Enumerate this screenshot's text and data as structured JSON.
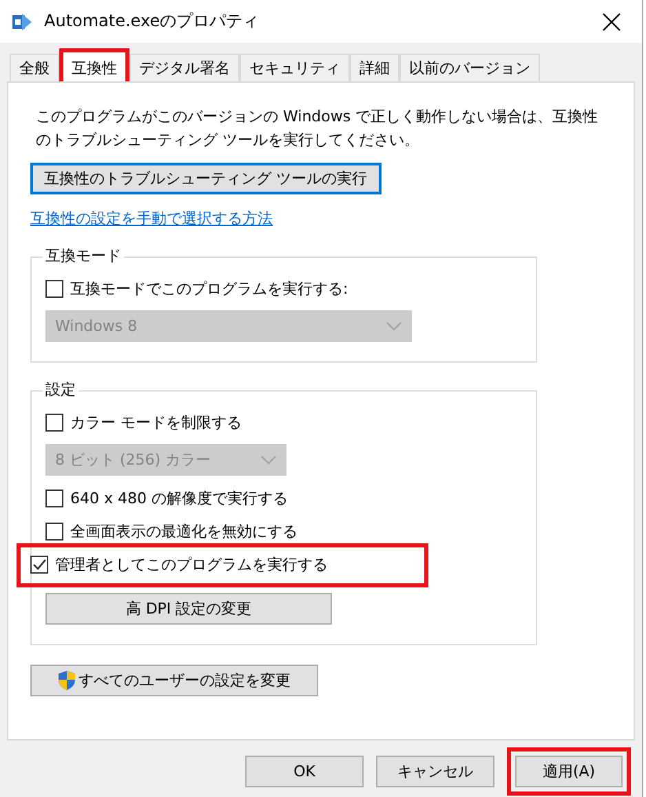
{
  "window": {
    "title": "Automate.exeのプロパティ"
  },
  "tabs": [
    {
      "label": "全般",
      "selected": false,
      "highlighted": false
    },
    {
      "label": "互換性",
      "selected": true,
      "highlighted": true
    },
    {
      "label": "デジタル署名",
      "selected": false,
      "highlighted": false
    },
    {
      "label": "セキュリティ",
      "selected": false,
      "highlighted": false
    },
    {
      "label": "詳細",
      "selected": false,
      "highlighted": false
    },
    {
      "label": "以前のバージョン",
      "selected": false,
      "highlighted": false
    }
  ],
  "description": "このプログラムがこのバージョンの Windows で正しく動作しない場合は、互換性のトラブルシューティング ツールを実行してください。",
  "troubleshoot_button": {
    "label": "互換性のトラブルシューティング ツールの実行",
    "focused": true
  },
  "help_link": "互換性の設定を手動で選択する方法",
  "groups": [
    {
      "title": "互換モード",
      "items": [
        {
          "kind": "checkbox",
          "label": "互換モードでこのプログラムを実行する:",
          "checked": false,
          "highlighted": false
        },
        {
          "kind": "dropdown",
          "value": "Windows 8",
          "disabled": true
        }
      ]
    },
    {
      "title": "設定",
      "items": [
        {
          "kind": "checkbox",
          "label": "カラー モードを制限する",
          "checked": false,
          "highlighted": false
        },
        {
          "kind": "dropdown",
          "value": "8 ビット (256) カラー",
          "disabled": true
        },
        {
          "kind": "checkbox",
          "label": "640 x 480 の解像度で実行する",
          "checked": false,
          "highlighted": false
        },
        {
          "kind": "checkbox",
          "label": "全画面表示の最適化を無効にする",
          "checked": false,
          "highlighted": false
        },
        {
          "kind": "checkbox",
          "label": "管理者としてこのプログラムを実行する",
          "checked": true,
          "highlighted": true
        },
        {
          "kind": "button",
          "label": "高 DPI 設定の変更"
        }
      ]
    }
  ],
  "all_users_button": {
    "label": "すべてのユーザーの設定を変更",
    "shield": true
  },
  "buttons": [
    {
      "label": "OK",
      "highlighted": false
    },
    {
      "label": "キャンセル",
      "highlighted": false
    },
    {
      "label": "適用(A)",
      "highlighted": true
    }
  ]
}
